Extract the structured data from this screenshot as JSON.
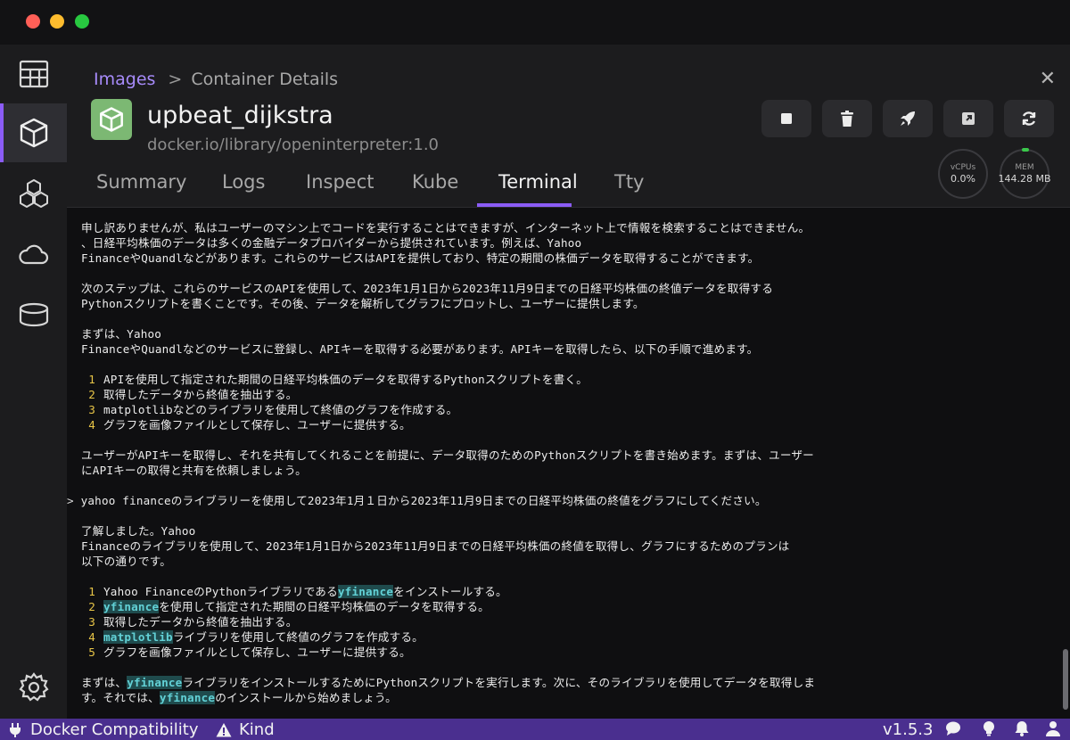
{
  "breadcrumb": {
    "parent": "Images",
    "current": "Container Details"
  },
  "container": {
    "name": "upbeat_dijkstra",
    "image": "docker.io/library/openinterpreter:1.0"
  },
  "gauges": {
    "cpu": {
      "label": "vCPUs",
      "value": "0.0%"
    },
    "mem": {
      "label": "MEM",
      "value": "144.28 MB"
    }
  },
  "tabs": [
    "Summary",
    "Logs",
    "Inspect",
    "Kube",
    "Terminal",
    "Tty"
  ],
  "active_tab": "Terminal",
  "terminal": {
    "p1a": "申し訳ありませんが、私はユーザーのマシン上でコードを実行することはできますが、インターネット上で情報を検索することはできません。",
    "p1b": "、日経平均株価のデータは多くの金融データプロバイダーから提供されています。例えば、Yahoo",
    "p1c": "FinanceやQuandlなどがあります。これらのサービスはAPIを提供しており、特定の期間の株価データを取得することができます。",
    "p2a": "次のステップは、これらのサービスのAPIを使用して、2023年1月1日から2023年11月9日までの日経平均株価の終値データを取得する",
    "p2b": "Pythonスクリプトを書くことです。その後、データを解析してグラフにプロットし、ユーザーに提供します。",
    "p3a": "まずは、Yahoo",
    "p3b": "FinanceやQuandlなどのサービスに登録し、APIキーを取得する必要があります。APIキーを取得したら、以下の手順で進めます。",
    "list1": [
      "APIを使用して指定された期間の日経平均株価のデータを取得するPythonスクリプトを書く。",
      "取得したデータから終値を抽出する。",
      "matplotlibなどのライブラリを使用して終値のグラフを作成する。",
      "グラフを画像ファイルとして保存し、ユーザーに提供する。"
    ],
    "p4a": "ユーザーがAPIキーを取得し、それを共有してくれることを前提に、データ取得のためのPythonスクリプトを書き始めます。まずは、ユーザー",
    "p4b": "にAPIキーの取得と共有を依頼しましょう。",
    "prompt_symbol": ">",
    "user_input": "yahoo financeのライブラリーを使用して2023年1月１日から2023年11月9日までの日経平均株価の終値をグラフにしてください。",
    "p5a": "了解しました。Yahoo",
    "p5b": "Financeのライブラリを使用して、2023年1月1日から2023年11月9日までの日経平均株価の終値を取得し、グラフにするためのプランは",
    "p5c": "以下の通りです。",
    "l2_1a": "Yahoo FinanceのPythonライブラリである",
    "l2_1b": "yfinance",
    "l2_1c": "をインストールする。",
    "l2_2a": "yfinance",
    "l2_2b": "を使用して指定された期間の日経平均株価のデータを取得する。",
    "l2_3": "取得したデータから終値を抽出する。",
    "l2_4a": "matplotlib",
    "l2_4b": "ライブラリを使用して終値のグラフを作成する。",
    "l2_5": "グラフを画像ファイルとして保存し、ユーザーに提供する。",
    "p6a1": "まずは、",
    "p6a2": "yfinance",
    "p6a3": "ライブラリをインストールするためにPythonスクリプトを実行します。次に、そのライブラリを使用してデータを取得しま",
    "p6b1": "す。それでは、",
    "p6b2": "yfinance",
    "p6b3": "のインストールから始めましょう。"
  },
  "list_numbers": [
    "1",
    "2",
    "3",
    "4",
    "5"
  ],
  "statusbar": {
    "compat": "Docker Compatibility",
    "kind": "Kind",
    "version": "v1.5.3"
  },
  "close_glyph": "✕",
  "colors": {
    "accent": "#8b5cf6",
    "statusbar": "#4a2f8f",
    "container_icon": "#7cb873",
    "highlight": "#62d1d6",
    "list_number": "#e8c547"
  }
}
